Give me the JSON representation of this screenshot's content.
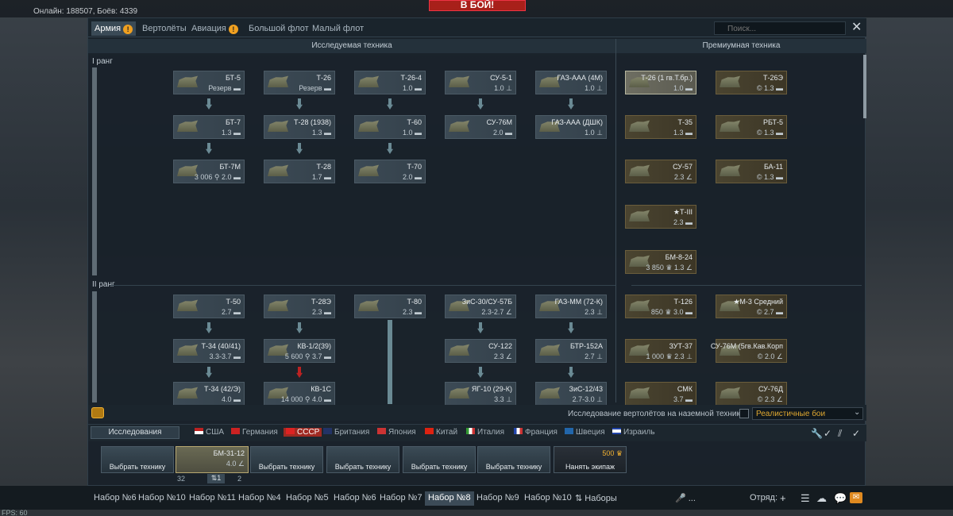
{
  "top": {
    "online": "Онлайн: 188507, Боёв: 4339",
    "battle_button": "В БОЙ!",
    "fps": "FPS: 60"
  },
  "tabs": [
    {
      "label": "Армия",
      "warn": true
    },
    {
      "label": "Вертолёты",
      "warn": false
    },
    {
      "label": "Авиация",
      "warn": true
    },
    {
      "label": "Большой флот",
      "warn": false
    },
    {
      "label": "Малый флот",
      "warn": false
    }
  ],
  "warn_glyph": "!",
  "search": {
    "placeholder": "Поиск..."
  },
  "close_glyph": "✕",
  "columns": {
    "researchable": "Исследуемая техника",
    "premium": "Премиумная техника"
  },
  "ranks": {
    "r1": "I ранг",
    "r2": "II ранг"
  },
  "vehicles": [
    {
      "name": "БТ-5",
      "br": "Резерв ▬"
    },
    {
      "name": "Т-26",
      "br": "Резерв ▬"
    },
    {
      "name": "Т-26-4",
      "br": "1.0 ▬"
    },
    {
      "name": "СУ-5-1",
      "br": "1.0 ⊥"
    },
    {
      "name": "ГАЗ-ААА (4М)",
      "br": "1.0 ⊥"
    },
    {
      "name": "БТ-7",
      "br": "1.3 ▬"
    },
    {
      "name": "Т-28 (1938)",
      "br": "1.3 ▬"
    },
    {
      "name": "Т-60",
      "br": "1.0 ▬"
    },
    {
      "name": "СУ-76М",
      "br": "2.0 ▬"
    },
    {
      "name": "ГАЗ-ААА (ДШК)",
      "br": "1.0 ⊥"
    },
    {
      "name": "БТ-7М",
      "br": "3 006 ⚲ 2.0 ▬"
    },
    {
      "name": "Т-28",
      "br": "1.7 ▬"
    },
    {
      "name": "Т-70",
      "br": "2.0 ▬"
    },
    {
      "name": "Т-50",
      "br": "2.7 ▬"
    },
    {
      "name": "Т-28Э",
      "br": "2.3 ▬"
    },
    {
      "name": "Т-80",
      "br": "2.3 ▬"
    },
    {
      "name": "ЗиС-30/СУ-57Б",
      "br": "2.3-2.7 ∠"
    },
    {
      "name": "ГАЗ-ММ (72-К)",
      "br": "2.3 ⊥"
    },
    {
      "name": "Т-34 (40/41)",
      "br": "3.3-3.7 ▬"
    },
    {
      "name": "КВ-1/2(39)",
      "br": "5 600 ⚲ 3.7 ▬"
    },
    {
      "name": "СУ-122",
      "br": "2.3 ∠"
    },
    {
      "name": "БТР-152А",
      "br": "2.7 ⊥"
    },
    {
      "name": "Т-34 (42/Э)",
      "br": "4.0 ▬"
    },
    {
      "name": "КВ-1С",
      "br": "14 000 ⚲ 4.0 ▬"
    },
    {
      "name": "ЯГ-10 (29-К)",
      "br": "3.3 ⊥"
    },
    {
      "name": "ЗиС-12/43",
      "br": "2.7-3.0 ⊥"
    }
  ],
  "premium": [
    {
      "name": "Т-26 (1 гв.Т.бр.)",
      "br": "1.0 ▬"
    },
    {
      "name": "Т-26Э",
      "br": "© 1.3 ▬"
    },
    {
      "name": "Т-35",
      "br": "1.3 ▬"
    },
    {
      "name": "РБТ-5",
      "br": "© 1.3 ▬"
    },
    {
      "name": "СУ-57",
      "br": "2.3 ∠"
    },
    {
      "name": "БА-11",
      "br": "© 1.3 ▬"
    },
    {
      "name": "★Т-III",
      "br": "2.3 ▬"
    },
    {
      "name": "БМ-8-24",
      "br": "3 850 ♛ 1.3 ∠"
    },
    {
      "name": "Т-126",
      "br": "850 ♛ 3.0 ▬"
    },
    {
      "name": "★М-3 Средний",
      "br": "© 2.7 ▬"
    },
    {
      "name": "ЗУТ-37",
      "br": "1 000 ♛ 2.3 ⊥"
    },
    {
      "name": "СУ-76М (5гв.Кав.Корп",
      "br": "© 2.0 ∠"
    },
    {
      "name": "СМК",
      "br": "3.7 ▬"
    },
    {
      "name": "СУ-76Д",
      "br": "© 2.3 ∠"
    }
  ],
  "bottom": {
    "heli_text": "Исследование вертолётов на наземной технике",
    "mode": "Реалистичные бои",
    "research_btn": "Исследования",
    "nations": [
      "США",
      "Германия",
      "СССР",
      "Британия",
      "Япония",
      "Китай",
      "Италия",
      "Франция",
      "Швеция",
      "Израиль"
    ],
    "crew": [
      {
        "label": "Выбрать технику"
      },
      {
        "label": "БМ-31-12",
        "br": "4.0 ∠"
      },
      {
        "label": "Выбрать технику"
      },
      {
        "label": "Выбрать технику"
      },
      {
        "label": "Выбрать технику"
      },
      {
        "label": "Выбрать технику"
      },
      {
        "label": "Нанять экипаж",
        "cost": "500 ♛"
      }
    ],
    "crew_stats": {
      "left": "32",
      "mid": "⇅1",
      "right": "2"
    },
    "presets": [
      "Набор №6",
      "Набор №10",
      "Набор №11",
      "Набор №4",
      "Набор №5",
      "Набор №6",
      "Набор №7",
      "Набор №8",
      "Набор №9",
      "Набор №10"
    ],
    "presets_menu": "⇅ Наборы",
    "mic": "🎤 ...",
    "squad": "Отряд:",
    "squad_add": "+"
  },
  "colors": {
    "accent": "#e0a830",
    "battle": "#a8201a",
    "active_nation": "#a02a22"
  }
}
